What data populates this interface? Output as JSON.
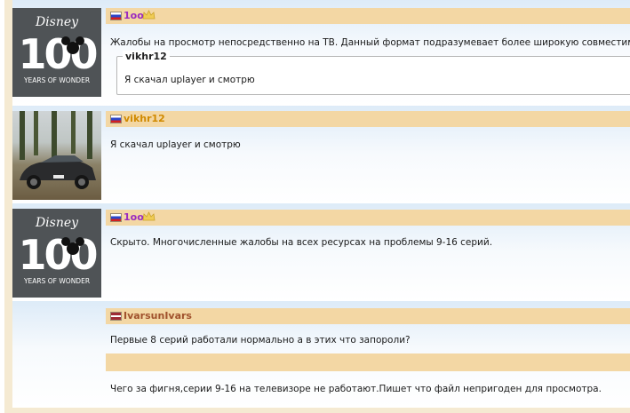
{
  "posts": [
    {
      "avatar": {
        "type": "disney",
        "logo_text": "Disney",
        "number": "100",
        "subtitle": "YEARS OF WONDER"
      },
      "username": "1oo",
      "flag": "russia",
      "has_crown": true,
      "message": "Жалобы на просмотр непосредственно на ТВ. Данный формат подразумевает более широкую совместимость.",
      "quote": {
        "author": "vikhr12",
        "text": "Я скачал uplayer и смотрю"
      }
    },
    {
      "avatar": {
        "type": "car"
      },
      "username": "vikhr12",
      "flag": "russia",
      "has_crown": false,
      "message": "Я скачал uplayer и смотрю"
    },
    {
      "avatar": {
        "type": "disney",
        "logo_text": "Disney",
        "number": "100",
        "subtitle": "YEARS OF WONDER"
      },
      "username": "1oo",
      "flag": "russia",
      "has_crown": true,
      "message": "Скрыто. Многочисленные жалобы на всех ресурсах на проблемы 9-16 серий."
    },
    {
      "avatar": null,
      "username": "IvarsunIvars",
      "flag": "latvia",
      "has_crown": false,
      "message": "Первые 8 серий работали нормально а в этих что запороли?",
      "message_2": "Чего за фигня,серии 9-16 на телевизоре не работают.Пишет что файл непригоден для просмотра."
    }
  ],
  "colors": {
    "header_bar": "#f3d7a4",
    "frame": "#f5ead2",
    "post_top": "#ddebf8",
    "username_purple": "#9a2bbf",
    "username_orange": "#d08a00",
    "username_brown": "#a0522d",
    "crown": "#e6b422"
  }
}
